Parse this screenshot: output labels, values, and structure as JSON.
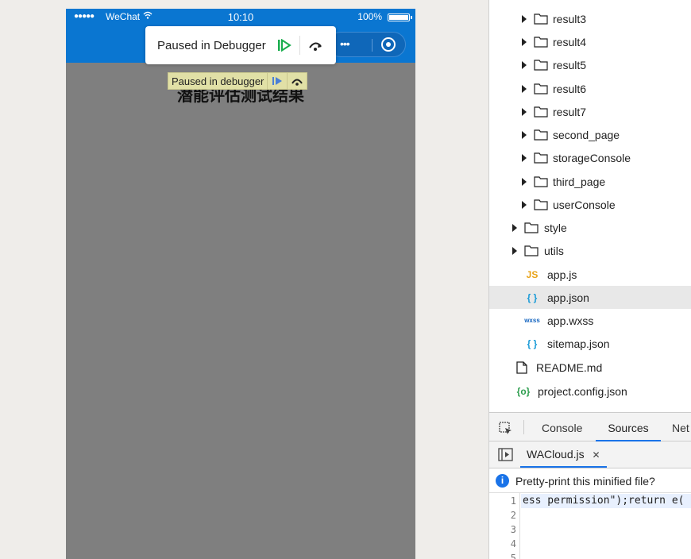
{
  "simulator": {
    "status": {
      "signal": "●●●●●",
      "carrier": "WeChat",
      "time": "10:10",
      "battery": "100%"
    },
    "page_title": "潜能评估测试结果",
    "paused_popup": {
      "label": "Paused in Debugger"
    },
    "paused_overlay": {
      "label": "Paused in debugger"
    },
    "capsule_dots": "•••"
  },
  "devtools": {
    "tree": [
      {
        "name": "result3",
        "type": "folder"
      },
      {
        "name": "result4",
        "type": "folder"
      },
      {
        "name": "result5",
        "type": "folder"
      },
      {
        "name": "result6",
        "type": "folder"
      },
      {
        "name": "result7",
        "type": "folder"
      },
      {
        "name": "second_page",
        "type": "folder"
      },
      {
        "name": "storageConsole",
        "type": "folder"
      },
      {
        "name": "third_page",
        "type": "folder"
      },
      {
        "name": "userConsole",
        "type": "folder"
      },
      {
        "name": "style",
        "type": "folder"
      },
      {
        "name": "utils",
        "type": "folder"
      },
      {
        "name": "app.js",
        "type": "js",
        "icon": "JS"
      },
      {
        "name": "app.json",
        "type": "json",
        "icon": "{ }"
      },
      {
        "name": "app.wxss",
        "type": "wxss",
        "icon": "wxss"
      },
      {
        "name": "sitemap.json",
        "type": "json",
        "icon": "{ }"
      },
      {
        "name": "README.md",
        "type": "file"
      },
      {
        "name": "project.config.json",
        "type": "config",
        "icon": "{o}"
      }
    ],
    "tabs": [
      "Console",
      "Sources",
      "Net"
    ],
    "active_tab": "Sources",
    "open_file": "WACloud.js",
    "close_glyph": "✕",
    "info_icon": "i",
    "pretty_print_prompt": "Pretty-print this minified file?",
    "line_numbers": [
      "1",
      "2",
      "3",
      "4",
      "5"
    ],
    "code_line_1": "ess permission\");return e(",
    "colors": {
      "accent": "#1a73e8",
      "js_icon": "#e8a317",
      "json_icon": "#1a9bd7",
      "wxss_icon": "#1565c0",
      "config_icon": "#2e9e4f"
    }
  }
}
